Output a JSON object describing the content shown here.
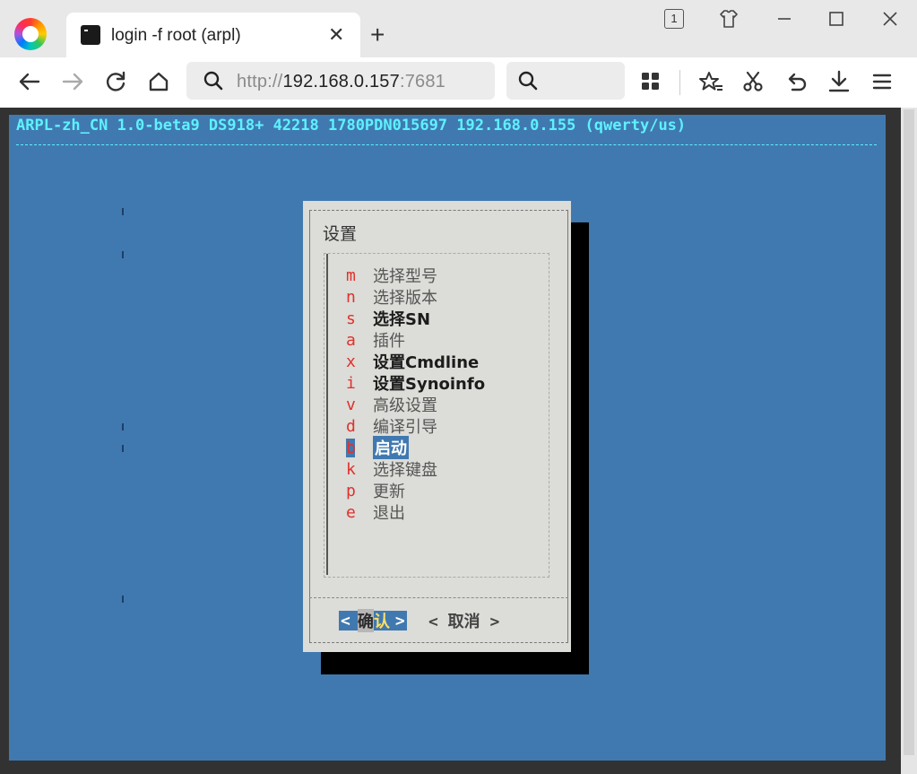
{
  "tab": {
    "title": "login -f root (arpl)",
    "close_glyph": "✕"
  },
  "new_tab_glyph": "+",
  "tab_count": "1",
  "url": {
    "host": "192.168.0.157",
    "scheme": "http://",
    "port": ":7681"
  },
  "terminal": {
    "header": "ARPL-zh_CN 1.0-beta9 DS918+ 42218 1780PDN015697 192.168.0.155 (qwerty/us)",
    "background_color": "#4079b0",
    "header_color": "#5ef1ff"
  },
  "dialog": {
    "title": "设置",
    "menu": [
      {
        "key": "m",
        "label": "选择型号"
      },
      {
        "key": "n",
        "label": "选择版本"
      },
      {
        "key": "s",
        "label": "选择SN"
      },
      {
        "key": "a",
        "label": "插件"
      },
      {
        "key": "x",
        "label": "设置Cmdline"
      },
      {
        "key": "i",
        "label": "设置Synoinfo"
      },
      {
        "key": "v",
        "label": "高级设置"
      },
      {
        "key": "d",
        "label": "编译引导"
      },
      {
        "key": "b",
        "label": "启动"
      },
      {
        "key": "k",
        "label": "选择键盘"
      },
      {
        "key": "p",
        "label": "更新"
      },
      {
        "key": "e",
        "label": "退出"
      }
    ],
    "selected_key": "b",
    "ok": {
      "left": "<",
      "first": "确",
      "second": "认",
      "right": ">"
    },
    "cancel": "< 取消 >"
  }
}
